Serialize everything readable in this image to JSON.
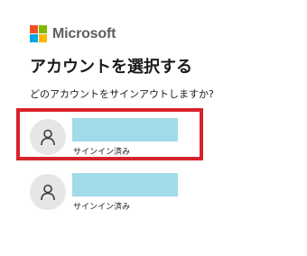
{
  "header": {
    "brand_name": "Microsoft",
    "logo_icon": "microsoft-logo-icon",
    "logo_colors": [
      "#f25022",
      "#7fba00",
      "#00a4ef",
      "#ffb900"
    ]
  },
  "main": {
    "title": "アカウントを選択する",
    "prompt": "どのアカウントをサインアウトしますか?",
    "accounts": [
      {
        "icon": "user-icon",
        "status": "サインイン済み",
        "highlighted": true
      },
      {
        "icon": "user-icon",
        "status": "サインイン済み",
        "highlighted": false
      }
    ]
  },
  "colors": {
    "highlight_border": "#d7222b",
    "redaction": "#a1dbea",
    "avatar_background": "#e6e6e6"
  }
}
